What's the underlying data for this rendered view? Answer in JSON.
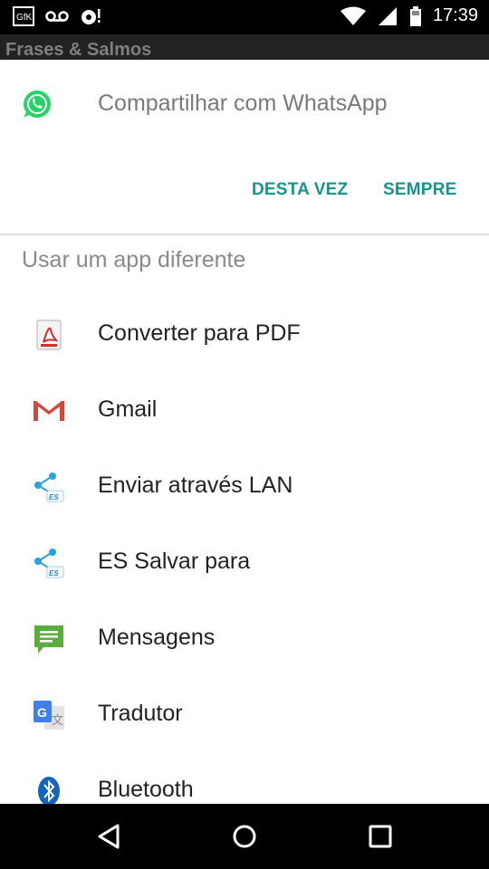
{
  "status_bar": {
    "time": "17:39",
    "left_icons": [
      "gfk-icon",
      "voicemail-icon",
      "android-debug-icon"
    ],
    "right_icons": [
      "wifi-icon",
      "signal-icon",
      "battery-icon"
    ]
  },
  "app_bar": {
    "title": "Frases & Salmos"
  },
  "chooser": {
    "primary_app": {
      "label": "Compartilhar com WhatsApp",
      "icon": "whatsapp-icon"
    },
    "buttons": {
      "just_once": "DESTA VEZ",
      "always": "SEMPRE"
    },
    "other_title": "Usar um app diferente",
    "apps": [
      {
        "label": "Converter para PDF",
        "icon": "pdf-icon"
      },
      {
        "label": "Gmail",
        "icon": "gmail-icon"
      },
      {
        "label": "Enviar através LAN",
        "icon": "es-share-icon"
      },
      {
        "label": "ES Salvar para",
        "icon": "es-share-icon"
      },
      {
        "label": "Mensagens",
        "icon": "messages-icon"
      },
      {
        "label": "Tradutor",
        "icon": "translate-icon"
      },
      {
        "label": "Bluetooth",
        "icon": "bluetooth-icon"
      }
    ]
  },
  "nav_bar": {
    "buttons": [
      "back-icon",
      "home-icon",
      "recents-icon"
    ]
  },
  "colors": {
    "accent": "#14968a",
    "whatsapp": "#25d366",
    "gmail": "#d44638"
  }
}
